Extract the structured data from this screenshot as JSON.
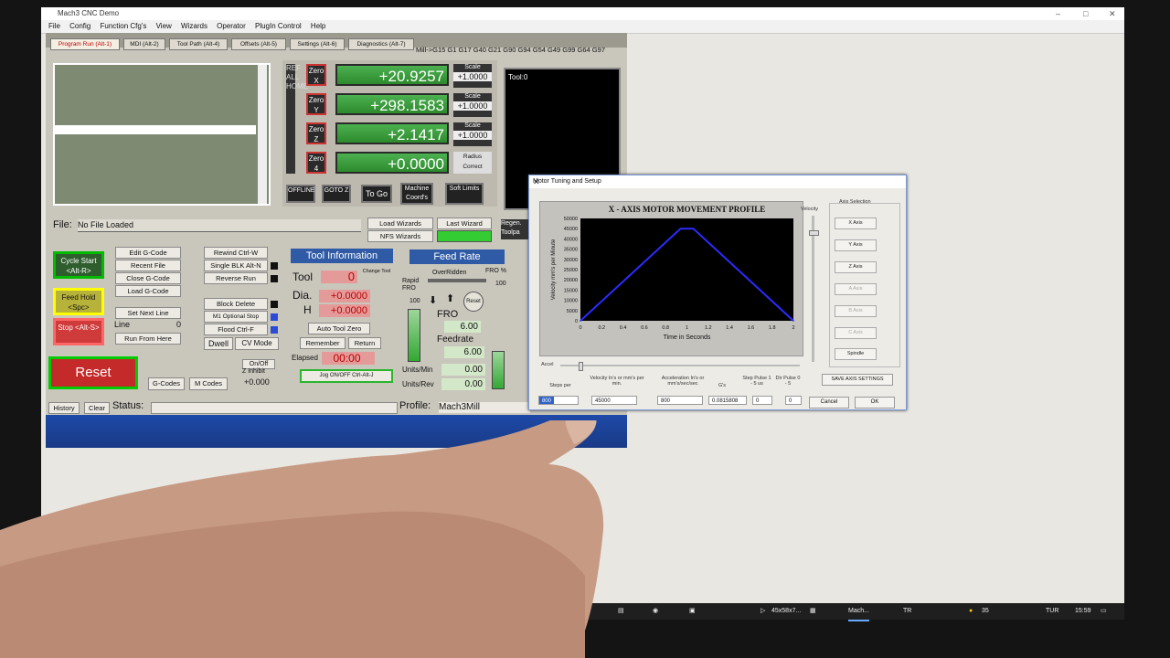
{
  "window": {
    "title": "Mach3 CNC  Demo"
  },
  "menu": [
    "File",
    "Config",
    "Function Cfg's",
    "View",
    "Wizards",
    "Operator",
    "PlugIn Control",
    "Help"
  ],
  "tabs": [
    "Program Run (Alt-1)",
    "MDI (Alt-2)",
    "Tool Path (Alt-4)",
    "Offsets (Alt-5)",
    "Settings (Alt-6)",
    "Diagnostics (Alt-7)"
  ],
  "gcode_modes": "Mill->G15  G1 G17 G40 G21 G90 G94 G54 G49 G99 G64 G97",
  "dro": {
    "refall": "REF ALL HOME",
    "zero_labels": [
      "Zero X",
      "Zero Y",
      "Zero Z",
      "Zero 4"
    ],
    "values": [
      "+20.9257",
      "+298.1583",
      "+2.1417",
      "+0.0000"
    ],
    "scale_label": "Scale",
    "scale_values": [
      "+1.0000",
      "+1.0000",
      "+1.0000"
    ],
    "radius_correct": "Radius Correct",
    "buttons": [
      "OFFLINE",
      "GOTO Z",
      "To Go",
      "Machine Coord's",
      "Soft Limits"
    ]
  },
  "tool_view": {
    "label": "Tool:0"
  },
  "file": {
    "label": "File:",
    "value": "No File Loaded"
  },
  "wizards": {
    "load": "Load Wizards",
    "last": "Last Wizard",
    "nfs": "NFS Wizards",
    "regen": "Regen. Toolpa"
  },
  "controls": {
    "cycle_start": "Cycle Start <Alt-R>",
    "feed_hold": "Feed Hold <Spc>",
    "stop": "Stop <Alt-S>",
    "reset": "Reset",
    "left_buttons": [
      "Edit G-Code",
      "Recent File",
      "Close G-Code",
      "Load G-Code",
      "Set Next Line"
    ],
    "line_label": "Line",
    "line_value": "0",
    "run_from_here": "Run From Here",
    "right_buttons": [
      "Rewind Ctrl-W",
      "Single BLK Alt-N",
      "Reverse Run",
      "Block Delete",
      "M1 Optional Stop",
      "Flood Ctrl-F"
    ],
    "dwell": "Dwell",
    "cv_mode": "CV Mode",
    "onoff": "On/Off",
    "z_inhibit": "Z Inhibit",
    "z_inhibit_value": "+0.000",
    "gcodes": "G-Codes",
    "mcodes": "M Codes"
  },
  "tool_info": {
    "title": "Tool Information",
    "tool_label": "Tool",
    "tool_value": "0",
    "change_label": "Change Tool",
    "dia_label": "Dia.",
    "dia_value": "+0.0000",
    "h_label": "H",
    "h_value": "+0.0000",
    "auto_zero": "Auto Tool Zero",
    "remember": "Remember",
    "return": "Return",
    "elapsed_label": "Elapsed",
    "elapsed_value": "00:00",
    "jog": "Jog ON/OFF Ctrl-Alt-J"
  },
  "feed": {
    "title": "Feed Rate",
    "overridden": "OverRidden",
    "fro_pct": "FRO %",
    "fro_pct_value": "100",
    "rapid_fro": "Rapid FRO",
    "rapid_value": "100",
    "reset": "Reset",
    "fro_label": "FRO",
    "fro_value": "6.00",
    "feedrate_label": "Feedrate",
    "feedrate_value": "6.00",
    "units_min_label": "Units/Min",
    "units_min_value": "0.00",
    "units_rev_label": "Units/Rev",
    "units_rev_value": "0.00"
  },
  "status": {
    "history": "History",
    "clear": "Clear",
    "label": "Status:",
    "profile_label": "Profile:",
    "profile_value": "Mach3Mill"
  },
  "dialog": {
    "title": "Motor Tuning and Setup",
    "chart_title": "X - AXIS MOTOR MOVEMENT PROFILE",
    "velocity_label": "Velocity",
    "accel_label": "Accel",
    "axis_selection": "Axis Selection",
    "axis_buttons": [
      "X Axis",
      "Y Axis",
      "Z Axis",
      "A Axis",
      "B Axis",
      "C Axis",
      "Spindle"
    ],
    "save": "SAVE AXIS SETTINGS",
    "fields": {
      "steps_label": "Steps per",
      "steps_value": "800",
      "velocity_label": "Velocity In's or mm's per min.",
      "velocity_value": "45000",
      "accel_label": "Acceleration In's or mm's/sec/sec",
      "accel_value": "800",
      "gs_label": "G's",
      "gs_value": "0.0815808",
      "step_pulse_label": "Step Pulse 1 - 5 us",
      "step_pulse_value": "0",
      "dir_pulse_label": "Dir Pulse 0 - 5",
      "dir_pulse_value": "0"
    },
    "cancel": "Cancel",
    "ok": "OK"
  },
  "chart_data": {
    "type": "line",
    "title": "X - AXIS MOTOR MOVEMENT PROFILE",
    "xlabel": "Time in Seconds",
    "ylabel": "Velocity  mm's per Minute",
    "xlim": [
      0,
      2
    ],
    "ylim": [
      0,
      50000
    ],
    "x_ticks": [
      "0",
      "0.2",
      "0.4",
      "0.6",
      "0.8",
      "1",
      "1.2",
      "1.4",
      "1.6",
      "1.8",
      "2"
    ],
    "y_ticks": [
      "50000",
      "45000",
      "40000",
      "35000",
      "30000",
      "25000",
      "20000",
      "15000",
      "10000",
      "5000",
      "0"
    ],
    "series": [
      {
        "x": [
          0,
          0.94,
          1.06,
          2.0
        ],
        "y": [
          0,
          45000,
          45000,
          0
        ]
      }
    ],
    "line_color": "#2b2bff",
    "plot_bg": "#000000"
  },
  "taskbar": {
    "app": "Mach...",
    "lang": "TR",
    "temp": "35",
    "layout": "TUR",
    "time": "15:59",
    "item": "45x58x7..."
  }
}
